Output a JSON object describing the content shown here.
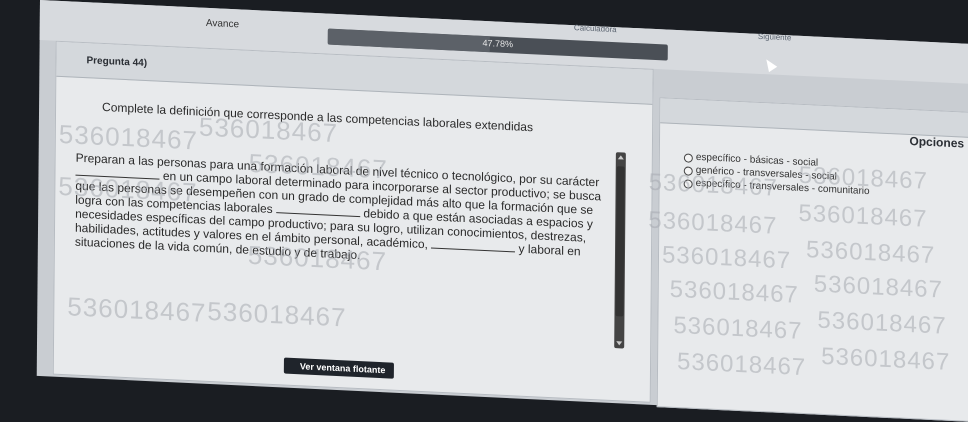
{
  "header": {
    "calculator_label": "Calculadora",
    "next_label": "Siguiente",
    "progress_label": "Avance",
    "progress_value": 47.78,
    "progress_text": "47.78%"
  },
  "question": {
    "title": "Pregunta 44)",
    "prompt": "Complete la definición que corresponde a las competencias laborales extendidas",
    "segments": [
      "Preparan a las personas para una formación laboral de nivel técnico o tecnológico, por su carácter",
      "en un campo laboral determinado para incorporarse al sector productivo; se busca que las personas se desempeñen con un grado de complejidad más alto que la formación que se logra con las competencias laborales",
      "debido a que están asociadas a espacios y necesidades específicas del campo productivo; para su logro, utilizan conocimientos, destrezas, habilidades, actitudes y valores en el ámbito personal, académico,",
      "y laboral en situaciones de la vida común, de estudio y de trabajo."
    ],
    "float_button_label": "Ver ventana flotante"
  },
  "options": {
    "title": "Opciones",
    "items": [
      "específico - básicas - social",
      "genérico - transversales - social",
      "específico - transversales - comunitario"
    ]
  },
  "watermark_text": "536018467"
}
